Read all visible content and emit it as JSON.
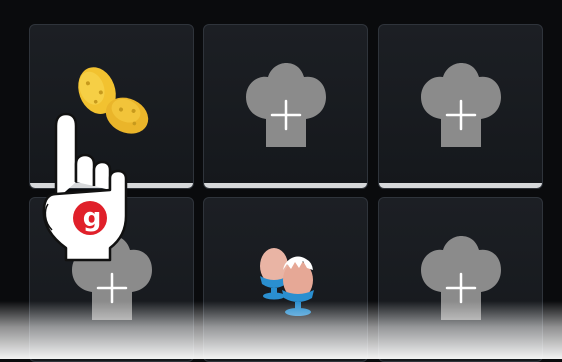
{
  "tiles": [
    {
      "name": "potatoes",
      "icon": "potatoes-icon",
      "selected": true
    },
    {
      "name": "add-recipe",
      "icon": "chef-hat-add-icon"
    },
    {
      "name": "add-recipe",
      "icon": "chef-hat-add-icon"
    },
    {
      "name": "add-recipe",
      "icon": "chef-hat-add-icon"
    },
    {
      "name": "eggs",
      "icon": "boiled-eggs-icon"
    },
    {
      "name": "add-recipe",
      "icon": "chef-hat-add-icon"
    }
  ],
  "pointer": {
    "icon": "hand-pointer-icon",
    "badge_letter": "g",
    "badge_color": "#e0202a"
  },
  "colors": {
    "background": "#0a0b0d",
    "tile": "#1a1d22",
    "hat": "#8b8b8b",
    "potato": "#f2c230",
    "egg_cup": "#2a8fd0",
    "egg_shell": "#e9b4a4"
  }
}
